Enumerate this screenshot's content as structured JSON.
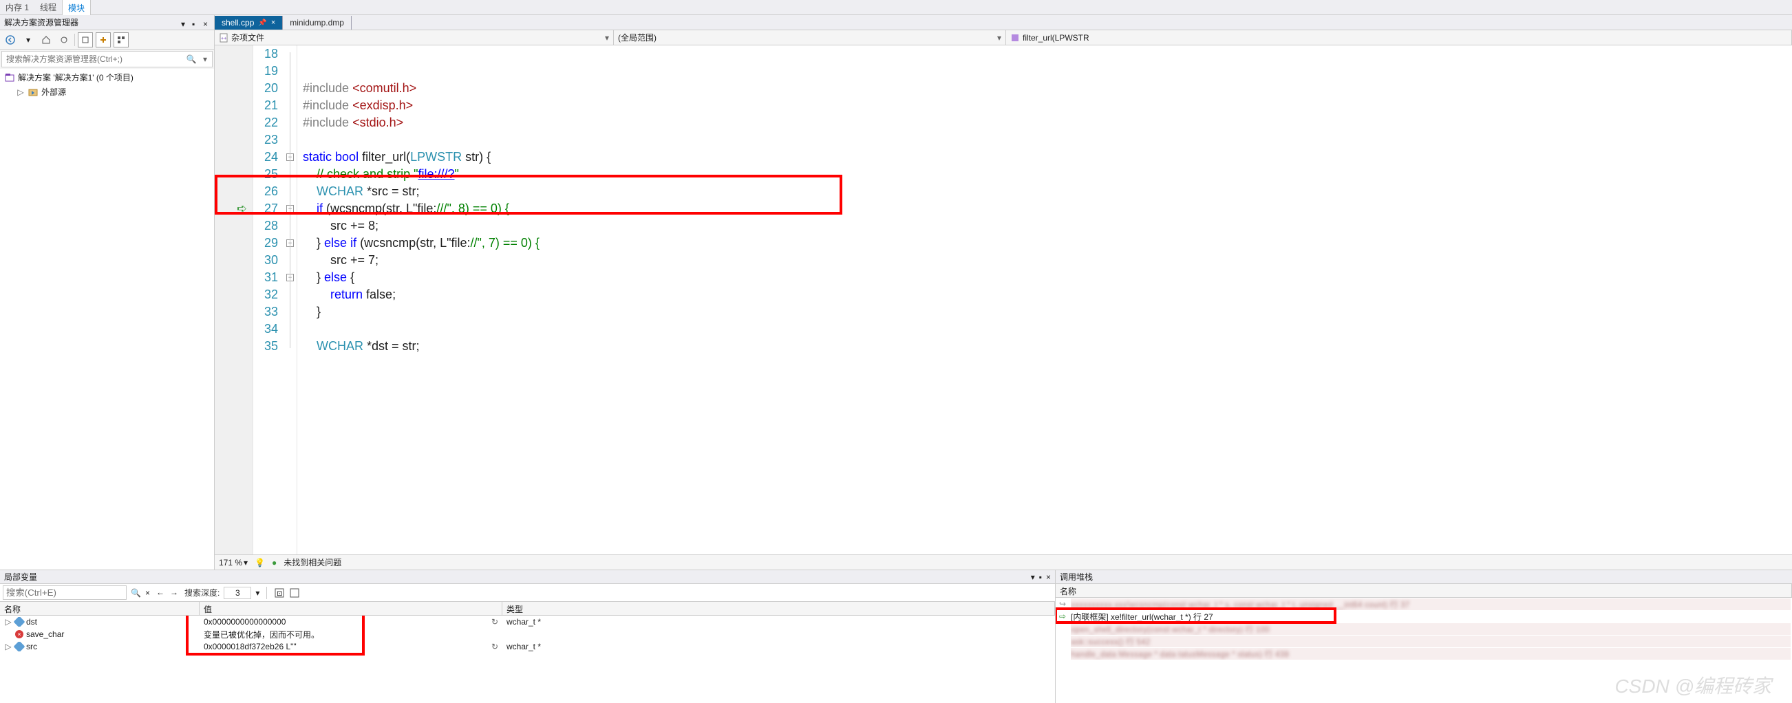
{
  "top_tabs": {
    "mem": "内存 1",
    "thr": "线程",
    "mod": "模块"
  },
  "solution": {
    "title": "解决方案资源管理器",
    "search_placeholder": "搜索解决方案资源管理器(Ctrl+;)",
    "root": "解决方案 '解决方案1' (0 个项目)",
    "ext_src": "外部源"
  },
  "editor": {
    "tabs": {
      "active": "shell.cpp",
      "other": "minidump.dmp"
    },
    "context": {
      "misc": "杂项文件",
      "scope": "(全局范围)",
      "fn": "filter_url(LPWSTR"
    },
    "lines": [
      {
        "n": 18,
        "t": ""
      },
      {
        "n": 19,
        "t": ""
      },
      {
        "n": 20,
        "t": "#include <comutil.h>"
      },
      {
        "n": 21,
        "t": "#include <exdisp.h>"
      },
      {
        "n": 22,
        "t": "#include <stdio.h>"
      },
      {
        "n": 23,
        "t": ""
      },
      {
        "n": 24,
        "t": "static bool filter_url(LPWSTR str) {"
      },
      {
        "n": 25,
        "t": "    // check and strip \"file:///?\""
      },
      {
        "n": 26,
        "t": "    WCHAR *src = str;"
      },
      {
        "n": 27,
        "t": "    if (wcsncmp(str, L\"file:///\", 8) == 0) {"
      },
      {
        "n": 28,
        "t": "        src += 8;"
      },
      {
        "n": 29,
        "t": "    } else if (wcsncmp(str, L\"file://\", 7) == 0) {"
      },
      {
        "n": 30,
        "t": "        src += 7;"
      },
      {
        "n": 31,
        "t": "    } else {"
      },
      {
        "n": 32,
        "t": "        return false;"
      },
      {
        "n": 33,
        "t": "    }"
      },
      {
        "n": 34,
        "t": ""
      },
      {
        "n": 35,
        "t": "    WCHAR *dst = str;"
      }
    ],
    "zoom": "171 %",
    "status_msg": "未找到相关问题"
  },
  "locals": {
    "title": "局部变量",
    "search_ph": "搜索(Ctrl+E)",
    "depth_label": "搜索深度:",
    "depth_val": "3",
    "cols": {
      "name": "名称",
      "val": "值",
      "ty": "类型"
    },
    "rows": [
      {
        "name": "dst",
        "val": "0x0000000000000000 <NULL>",
        "ty": "wchar_t *",
        "ok": true,
        "exp": true
      },
      {
        "name": "save_char",
        "val": "变量已被优化掉，因而不可用。",
        "ty": "",
        "ok": false,
        "exp": false
      },
      {
        "name": "src",
        "val": "0x0000018df372eb26 L\"\"",
        "ty": "wchar_t *",
        "ok": true,
        "exp": true
      }
    ]
  },
  "callstack": {
    "title": "调用堆栈",
    "col": "名称",
    "rows": [
      {
        "ind": "↪",
        "text": "xxxxxxxxxx.xxx!wcsncmp(const wchar_t * s, const wchar_t * t, unsigned __int64 count) 行 37",
        "hl": false,
        "blur": true
      },
      {
        "ind": "⇨",
        "text": "[内联框架]            xe!filter_url(wchar_t *) 行 27",
        "hl": true,
        "blur": false
      },
      {
        "ind": "",
        "text": "open_shell_directory(const wchar_t * directory) 行 100",
        "hl": false,
        "blur": true
      },
      {
        "ind": "",
        "text": "ask::success() 行 542",
        "hl": false,
        "blur": true
      },
      {
        "ind": "",
        "text": "handle_data                     Message * data                tatusMessage * status) 行 438",
        "hl": false,
        "blur": true
      }
    ]
  },
  "watermark": "CSDN @编程砖家"
}
